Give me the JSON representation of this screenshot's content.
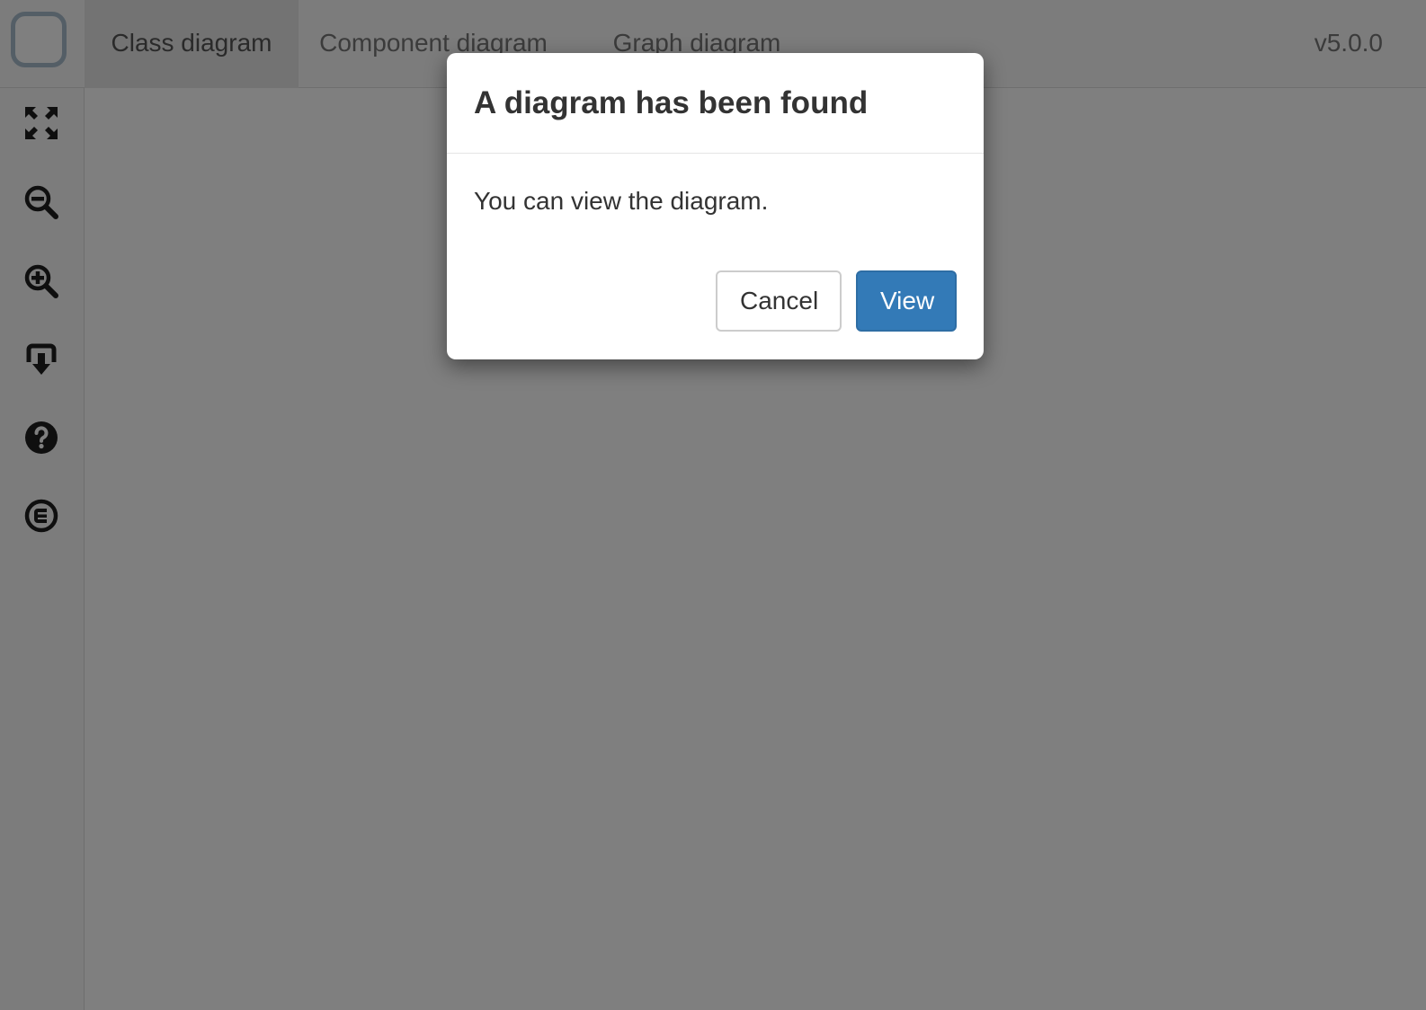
{
  "nav": {
    "tabs": [
      {
        "label": "Class diagram",
        "active": true
      },
      {
        "label": "Component diagram",
        "active": false
      },
      {
        "label": "Graph diagram",
        "active": false
      }
    ],
    "version": "v5.0.0"
  },
  "sidebar": {
    "tools": [
      {
        "icon": "fullscreen-icon"
      },
      {
        "icon": "zoom-out-icon"
      },
      {
        "icon": "zoom-in-icon"
      },
      {
        "icon": "download-icon"
      },
      {
        "icon": "help-icon"
      },
      {
        "icon": "copyright-icon"
      }
    ]
  },
  "dialog": {
    "title": "A diagram has been found",
    "message": "You can view the diagram.",
    "cancel_label": "Cancel",
    "view_label": "View"
  },
  "colors": {
    "primary": "#337ab7",
    "icon": "#1f1f1f",
    "backdrop": "rgba(0,0,0,0.5)"
  }
}
